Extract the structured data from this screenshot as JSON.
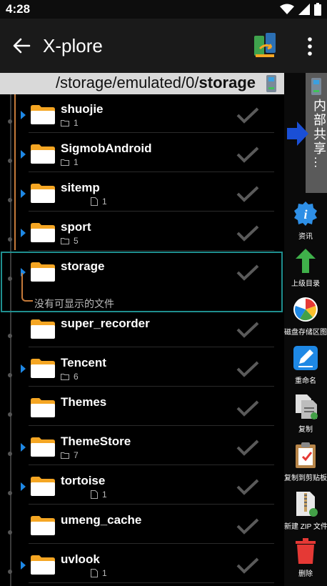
{
  "status_bar": {
    "time": "4:28"
  },
  "app_bar": {
    "title": "X-plore"
  },
  "path_bar": {
    "path_prefix": "/storage/emulated/0/",
    "path_current": "storage"
  },
  "side_tab": {
    "label": "内部共享…"
  },
  "folders": [
    {
      "name": "shuojie",
      "folders": "1",
      "files": ""
    },
    {
      "name": "SigmobAndroid",
      "folders": "1",
      "files": ""
    },
    {
      "name": "sitemp",
      "folders": "",
      "files": "1"
    },
    {
      "name": "sport",
      "folders": "5",
      "files": ""
    },
    {
      "name": "storage",
      "folders": "",
      "files": ""
    },
    {
      "name": "super_recorder",
      "folders": "",
      "files": ""
    },
    {
      "name": "Tencent",
      "folders": "6",
      "files": ""
    },
    {
      "name": "Themes",
      "folders": "",
      "files": ""
    },
    {
      "name": "ThemeStore",
      "folders": "7",
      "files": ""
    },
    {
      "name": "tortoise",
      "folders": "",
      "files": "1"
    },
    {
      "name": "umeng_cache",
      "folders": "",
      "files": ""
    },
    {
      "name": "uvlook",
      "folders": "",
      "files": "1"
    }
  ],
  "empty_message": "没有可显示的文件",
  "tools": [
    {
      "label": "资讯",
      "icon": "info-icon"
    },
    {
      "label": "上级目录",
      "icon": "up-arrow-icon"
    },
    {
      "label": "磁盘存储区图",
      "icon": "disk-map-icon"
    },
    {
      "label": "重命名",
      "icon": "rename-icon"
    },
    {
      "label": "复制",
      "icon": "copy-icon"
    },
    {
      "label": "复制到剪贴板",
      "icon": "clipboard-icon"
    },
    {
      "label": "新建 ZIP 文件",
      "icon": "zip-icon"
    },
    {
      "label": "删除",
      "icon": "trash-icon"
    }
  ],
  "colors": {
    "accent": "#1e88e5",
    "selection": "#1f8f8f",
    "tree": "#c57a3a",
    "folder": "#f5a623"
  }
}
